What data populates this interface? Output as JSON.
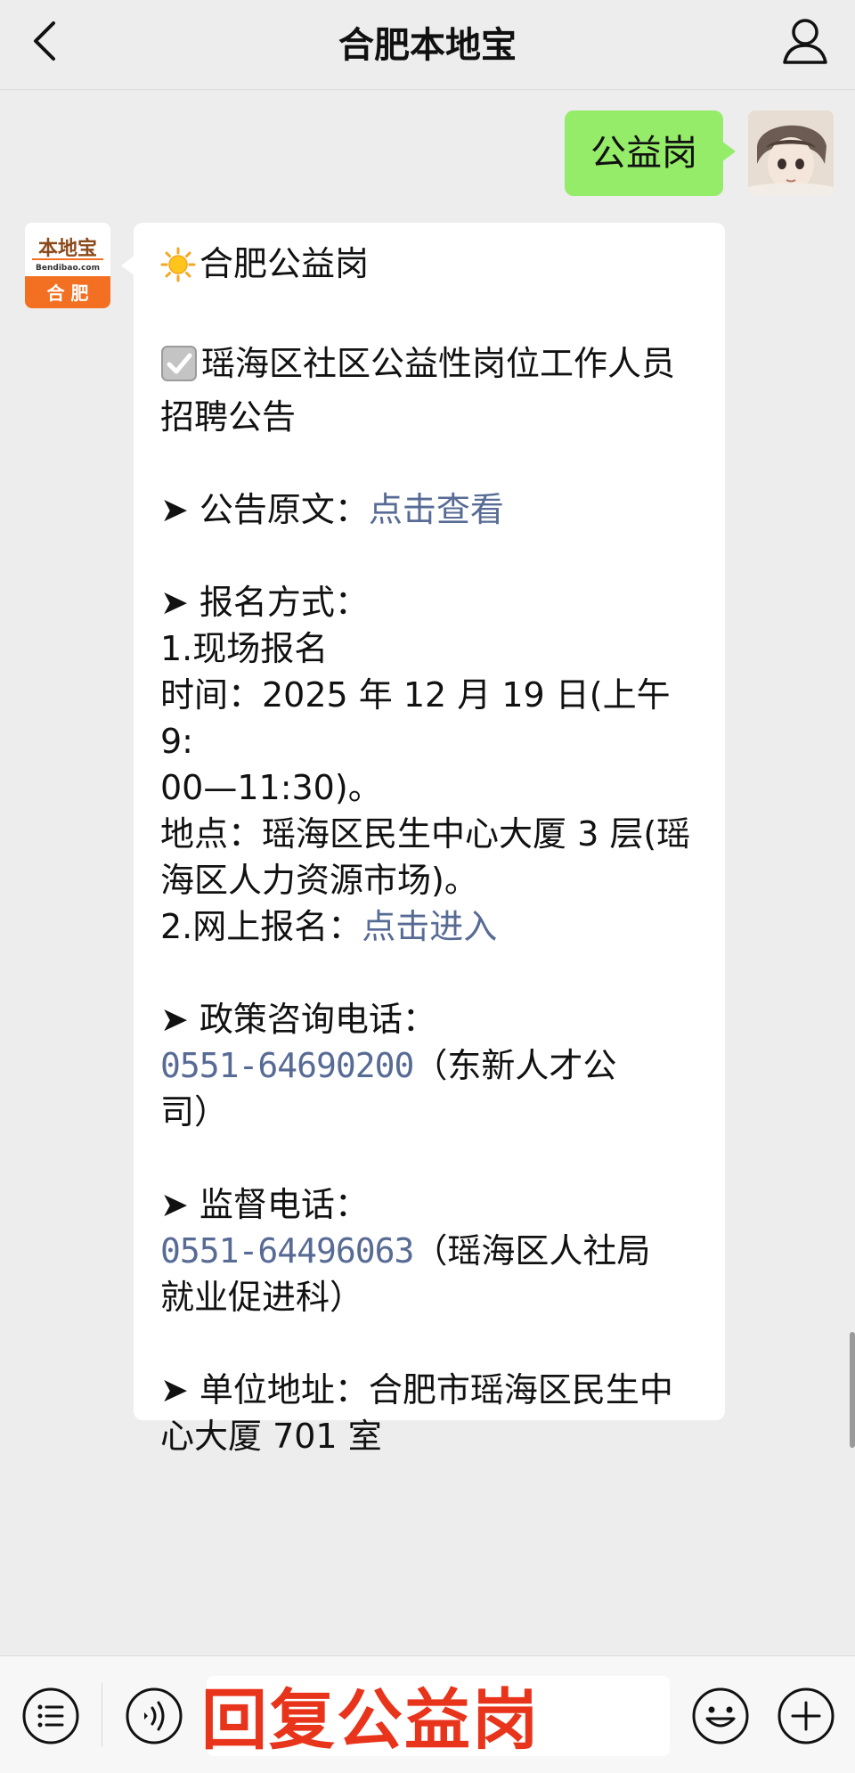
{
  "header": {
    "title": "合肥本地宝"
  },
  "chat": {
    "sent_message": "公益岗",
    "bot_avatar": {
      "logo_top": "本地宝",
      "logo_url": "Bendibao.com",
      "logo_city": "合 肥"
    },
    "reply": {
      "title": "合肥公益岗",
      "notice_title_line1": "瑶海区社区公益性岗位工作人员",
      "notice_title_line2": "招聘公告",
      "original_label": "➤ 公告原文：",
      "original_link": "点击查看",
      "register_label": "➤ 报名方式：",
      "onsite": "1.现场报名",
      "time_line1": "时间：2025 年 12 月 19 日(上午 9:",
      "time_line2": "00—11:30)。",
      "place_line1": "地点：瑶海区民生中心大厦 3 层(瑶",
      "place_line2": "海区人力资源市场)。",
      "online_label": "2.网上报名：",
      "online_link": "点击进入",
      "policy_label": "➤ 政策咨询电话：",
      "policy_phone": "0551-64690200",
      "policy_org_line1": "（东新人才公",
      "policy_org_line2": "司）",
      "supervise_label": "➤ 监督电话：",
      "supervise_phone": "0551-64496063",
      "supervise_org_line1": "（瑶海区人社局",
      "supervise_org_line2": "就业促进科）",
      "address_line1": "➤ 单位地址：合肥市瑶海区民生中",
      "address_line2": "心大厦 701 室"
    }
  },
  "bottom_bar": {
    "input_text": "回复公益岗"
  },
  "colors": {
    "sent_bubble": "#95ec69",
    "link": "#576b95",
    "input_highlight": "#e8341b",
    "logo_orange": "#f36f21"
  }
}
